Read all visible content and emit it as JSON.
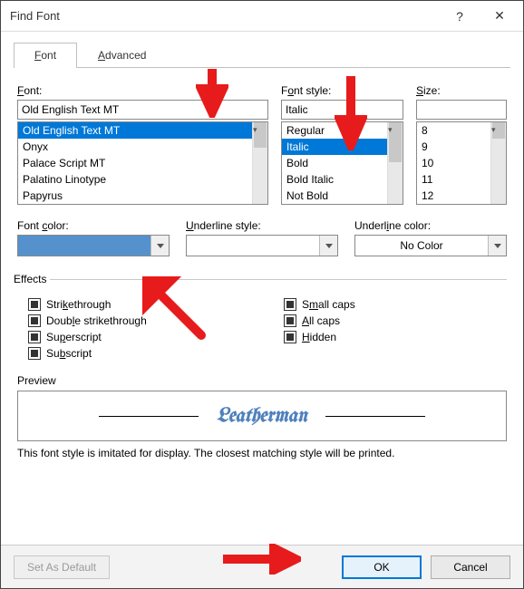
{
  "window": {
    "title": "Find Font",
    "help_label": "?",
    "close_label": "✕"
  },
  "tabs": {
    "font": "Font",
    "advanced": "Advanced"
  },
  "labels": {
    "font": "Font:",
    "font_style": "Font style:",
    "size": "Size:",
    "font_color": "Font color:",
    "underline_style": "Underline style:",
    "underline_color": "Underline color:",
    "effects": "Effects",
    "preview": "Preview"
  },
  "font": {
    "value": "Old English Text MT",
    "list": [
      "Old English Text MT",
      "Onyx",
      "Palace Script MT",
      "Palatino Linotype",
      "Papyrus"
    ],
    "selected_index": 0
  },
  "font_style": {
    "value": "Italic",
    "list": [
      "Regular",
      "Italic",
      "Bold",
      "Bold Italic",
      "Not Bold"
    ],
    "selected_index": 1
  },
  "size": {
    "value": "",
    "list": [
      "8",
      "9",
      "10",
      "11",
      "12"
    ]
  },
  "font_color": {
    "swatch": "#5591cd"
  },
  "underline_style": {
    "value": ""
  },
  "underline_color": {
    "value": "No Color"
  },
  "effects_list": {
    "strike": "Strikethrough",
    "dblstrike": "Double strikethrough",
    "superscript": "Superscript",
    "subscript": "Subscript",
    "smallcaps": "Small caps",
    "allcaps": "All caps",
    "hidden": "Hidden"
  },
  "preview": {
    "text": "Leatherman"
  },
  "note": "This font style is imitated for display. The closest matching style will be printed.",
  "buttons": {
    "set_default": "Set As Default",
    "ok": "OK",
    "cancel": "Cancel"
  }
}
